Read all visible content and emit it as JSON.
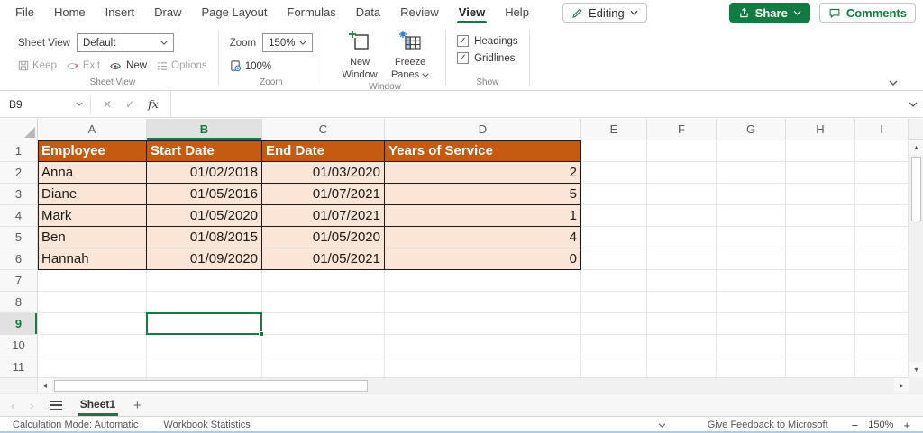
{
  "app": {
    "tabs": [
      "File",
      "Home",
      "Insert",
      "Draw",
      "Page Layout",
      "Formulas",
      "Data",
      "Review",
      "View",
      "Help"
    ],
    "active_tab": "View",
    "editing_label": "Editing",
    "share_label": "Share",
    "comments_label": "Comments"
  },
  "ribbon": {
    "sheet_view": {
      "group_label": "Sheet View",
      "field_label": "Sheet View",
      "dropdown_value": "Default",
      "keep_label": "Keep",
      "exit_label": "Exit",
      "new_label": "New",
      "options_label": "Options"
    },
    "zoom": {
      "group_label": "Zoom",
      "field_label": "Zoom",
      "dropdown_value": "150%",
      "button_100_label": "100%"
    },
    "window": {
      "group_label": "Window",
      "new_window_label": "New Window",
      "freeze_panes_label": "Freeze Panes"
    },
    "show": {
      "group_label": "Show",
      "headings_label": "Headings",
      "gridlines_label": "Gridlines",
      "headings_checked": true,
      "gridlines_checked": true
    }
  },
  "formula_bar": {
    "name_box": "B9",
    "fx_label": "fx",
    "formula_value": ""
  },
  "sheet": {
    "columns": [
      "A",
      "B",
      "C",
      "D",
      "E",
      "F",
      "G",
      "H",
      "I"
    ],
    "row_headers": [
      "1",
      "2",
      "3",
      "4",
      "5",
      "6",
      "7",
      "8",
      "9",
      "10",
      "11"
    ],
    "selected_column": "B",
    "selected_row": 9,
    "selected_cell": "B9",
    "header_row": {
      "cells": [
        "Employee",
        "Start Date",
        "End Date",
        "Years of Service"
      ]
    },
    "data_rows": [
      {
        "cells": [
          "Anna",
          "01/02/2018",
          "01/03/2020",
          "2"
        ]
      },
      {
        "cells": [
          "Diane",
          "01/05/2016",
          "01/07/2021",
          "5"
        ]
      },
      {
        "cells": [
          "Mark",
          "01/05/2020",
          "01/07/2021",
          "1"
        ]
      },
      {
        "cells": [
          "Ben",
          "01/08/2015",
          "01/05/2020",
          "4"
        ]
      },
      {
        "cells": [
          "Hannah",
          "01/09/2020",
          "01/05/2021",
          "0"
        ]
      }
    ]
  },
  "sheet_tabs": {
    "active": "Sheet1",
    "add_label": "+"
  },
  "status_bar": {
    "calc_mode": "Calculation Mode: Automatic",
    "workbook_stats": "Workbook Statistics",
    "feedback": "Give Feedback to Microsoft",
    "zoom_out": "−",
    "zoom_level": "150%",
    "zoom_in": "+"
  },
  "icons": {
    "up_arrow": "▴",
    "down_arrow": "▾",
    "left_arrow": "◂",
    "right_arrow": "▸",
    "prev_sheet": "‹",
    "next_sheet": "›",
    "cancel": "✕",
    "enter": "✓",
    "check": "✓"
  },
  "colors": {
    "accent_green": "#107C41",
    "header_orange": "#C55A11",
    "row_fill": "#FBE5D6"
  }
}
